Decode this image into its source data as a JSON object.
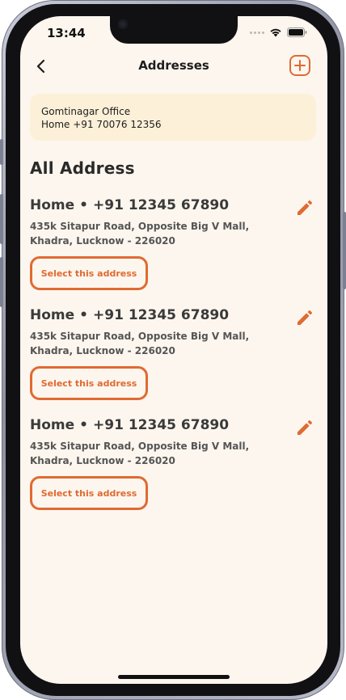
{
  "status_bar": {
    "time": "13:44"
  },
  "header": {
    "title": "Addresses",
    "back_icon": "chevron-left-icon",
    "add_icon": "plus-circle-icon"
  },
  "selected_address": {
    "name": "Gomtinagar Office",
    "label_phone": "Home +91 70076 12356"
  },
  "section_title": "All Address",
  "addresses": [
    {
      "label": "Home",
      "phone": "+91 12345 67890",
      "line1": "435k Sitapur Road, Opposite Big V Mall,",
      "line2": "Khadra, Lucknow - 226020",
      "button": "Select this address"
    },
    {
      "label": "Home",
      "phone": "+91 12345 67890",
      "line1": "435k Sitapur Road, Opposite Big V Mall,",
      "line2": "Khadra, Lucknow - 226020",
      "button": "Select this address"
    },
    {
      "label": "Home",
      "phone": "+91 12345 67890",
      "line1": "435k Sitapur Road, Opposite Big V Mall,",
      "line2": "Khadra, Lucknow - 226020",
      "button": "Select this address"
    }
  ],
  "colors": {
    "accent": "#e06a32",
    "background": "#fdf6ee",
    "card": "#fdf0d8"
  }
}
